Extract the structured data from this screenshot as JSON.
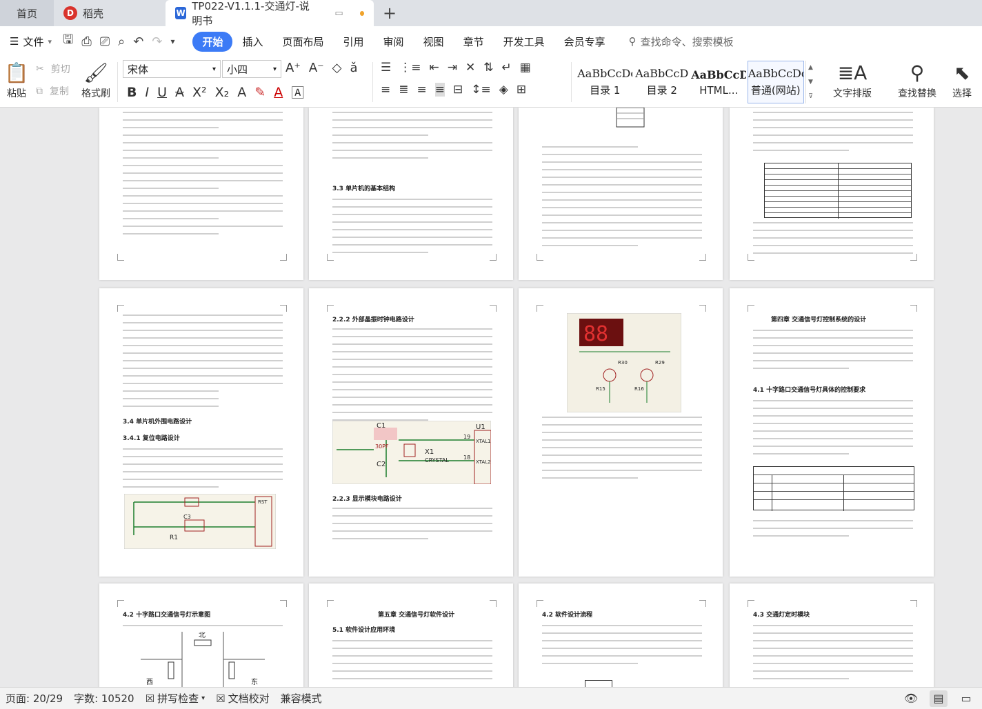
{
  "tabs": [
    {
      "label": "首页"
    },
    {
      "label": "稻壳"
    },
    {
      "label": "TP022-V1.1.1-交通灯-说明书"
    }
  ],
  "menu": {
    "file_label": "文件",
    "items": [
      "开始",
      "插入",
      "页面布局",
      "引用",
      "审阅",
      "视图",
      "章节",
      "开发工具",
      "会员专享"
    ],
    "search_placeholder": "查找命令、搜索模板"
  },
  "ribbon": {
    "paste": "粘贴",
    "cut": "剪切",
    "copy": "复制",
    "format_painter": "格式刷",
    "font_name": "宋体",
    "font_size": "小四",
    "styles": [
      {
        "sample": "AaBbCcDd",
        "name": "目录 1"
      },
      {
        "sample": "AaBbCcD",
        "name": "目录 2"
      },
      {
        "sample": "AaBbCcD",
        "name": "HTML..."
      },
      {
        "sample": "AaBbCcDd",
        "name": "普通(网站)"
      }
    ],
    "text_layout": "文字排版",
    "find_replace": "查找替换",
    "select": "选择"
  },
  "document": {
    "headings": {
      "p3": "3.3 单片机的基本结构",
      "p5": "3.4 单片机外围电路设计",
      "p5b": "3.4.1 复位电路设计",
      "p6": "2.2.2 外部晶振时钟电路设计",
      "p6b": "2.2.3 显示模块电路设计",
      "p8": "第四章 交通信号灯控制系统的设计",
      "p8b": "4.1 十字路口交通信号灯具体的控制要求",
      "p9": "4.2 十字路口交通信号灯示意图",
      "p10": "第五章 交通信号灯软件设计",
      "p10b": "5.1 软件设计应用环境",
      "p11": "4.2 软件设计流程",
      "p12": "4.3 交通灯定时模块"
    },
    "circuit_labels": {
      "c1": "C1",
      "c2": "C2",
      "x1": "X1",
      "crystal": "CRYSTAL",
      "u1": "U1",
      "xtal1": "XTAL1",
      "xtal2": "XTAL2",
      "pin19": "19",
      "pin18": "18",
      "cap_val": "30PF",
      "r1": "R1",
      "c3": "C3",
      "rst": "RST",
      "r30": "R30",
      "r29": "R29",
      "r15": "R15",
      "r16": "R16"
    },
    "map_labels": {
      "north": "北",
      "west": "西",
      "east": "东"
    }
  },
  "status": {
    "page": "页面: 20/29",
    "words": "字数: 10520",
    "spell": "拼写检查",
    "proof": "文档校对",
    "compat": "兼容模式"
  }
}
